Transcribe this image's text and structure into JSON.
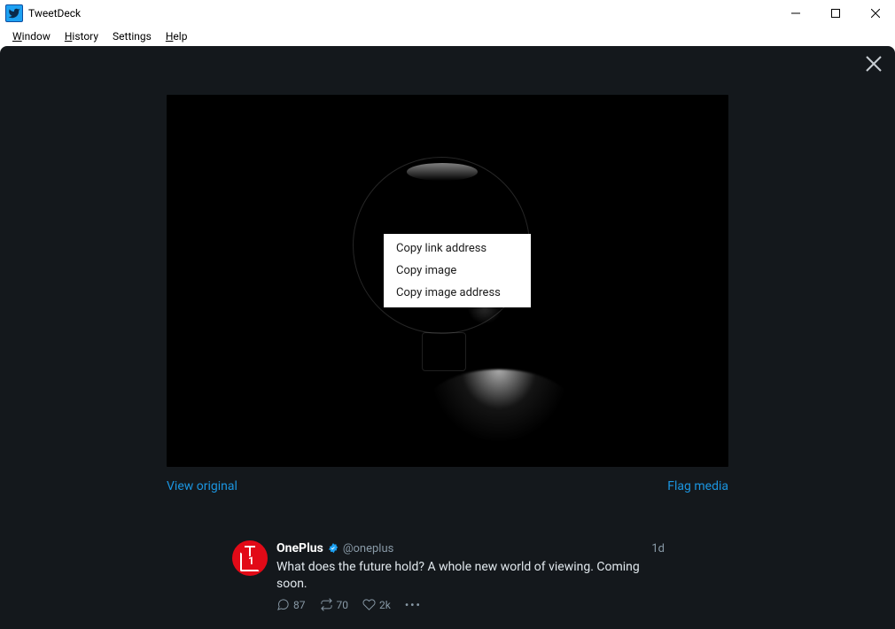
{
  "window": {
    "title": "TweetDeck"
  },
  "menubar": {
    "window": "Window",
    "history": "History",
    "settings": "Settings",
    "help": "Help"
  },
  "context_menu": {
    "items": [
      "Copy link address",
      "Copy image",
      "Copy image address"
    ]
  },
  "media": {
    "view_original": "View original",
    "flag_media": "Flag media"
  },
  "tweet": {
    "name": "OnePlus",
    "handle": "@oneplus",
    "time": "1d",
    "text": "What does the future hold? A whole new world of viewing. Coming soon.",
    "reply_count": "87",
    "retweet_count": "70",
    "like_count": "2k"
  }
}
